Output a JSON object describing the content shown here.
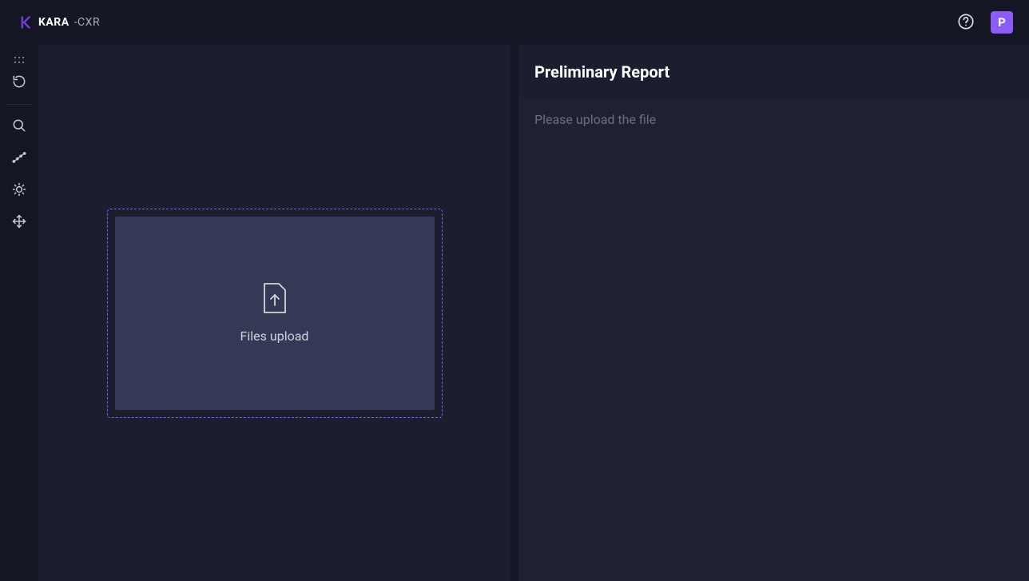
{
  "header": {
    "logo_word": "KARA",
    "logo_suffix": "-CXR",
    "avatar_initial": "P"
  },
  "sidebar": {
    "tools": [
      {
        "name": "drag-handle-icon"
      },
      {
        "name": "undo-icon"
      },
      {
        "name": "search-icon"
      },
      {
        "name": "line-icon"
      },
      {
        "name": "brightness-icon"
      },
      {
        "name": "move-icon"
      }
    ]
  },
  "viewer": {
    "upload_label": "Files upload"
  },
  "report": {
    "title": "Preliminary Report",
    "placeholder": "Please upload the file"
  }
}
